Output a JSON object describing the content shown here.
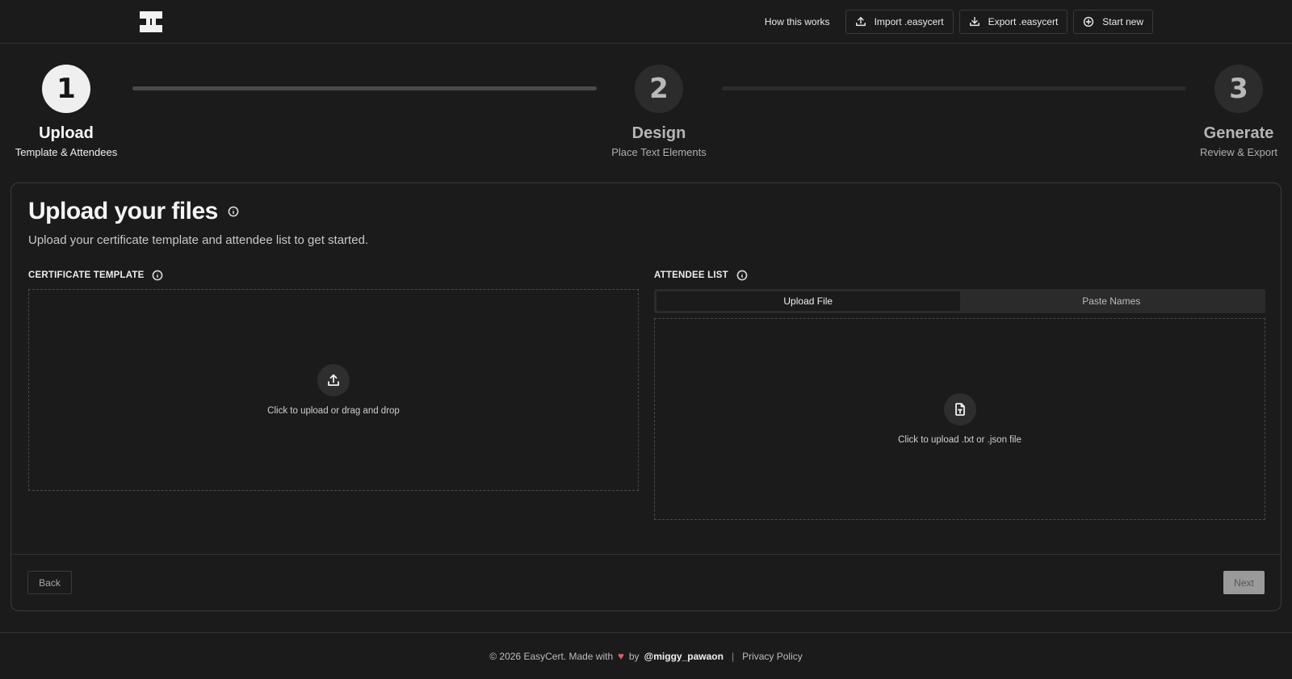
{
  "header": {
    "logo_icon": "easycert-logo-icon",
    "how_it_works": "How this works",
    "import_label": "Import .easycert",
    "import_icon": "upload-icon",
    "export_label": "Export .easycert",
    "export_icon": "download-icon",
    "start_new_label": "Start new",
    "start_new_icon": "plus-circle-icon"
  },
  "stepper": {
    "steps": [
      {
        "number": "1",
        "title": "Upload",
        "subtitle": "Template & Attendees",
        "state": "active"
      },
      {
        "number": "2",
        "title": "Design",
        "subtitle": "Place Text Elements",
        "state": "inactive"
      },
      {
        "number": "3",
        "title": "Generate",
        "subtitle": "Review & Export",
        "state": "inactive"
      }
    ],
    "colors": {
      "active_bar": "#4a4a4a",
      "inactive_bar": "#2c2c2c"
    }
  },
  "main": {
    "title": "Upload your files",
    "description": "Upload your certificate template and attendee list to get started.",
    "template": {
      "label": "CERTIFICATE TEMPLATE",
      "dropzone_text": "Click to upload or drag and drop",
      "dropzone_icon": "upload-icon"
    },
    "attendees": {
      "label": "ATTENDEE LIST",
      "tabs": [
        {
          "label": "Upload File",
          "active": true
        },
        {
          "label": "Paste Names",
          "active": false
        }
      ],
      "dropzone_text": "Click to upload .txt or .json file",
      "dropzone_icon": "file-text-icon"
    },
    "back_label": "Back",
    "next_label": "Next"
  },
  "footer": {
    "copyright": "© 2026 EasyCert. Made with",
    "heart": "♥",
    "by": "by",
    "handle": "@miggy_pawaon",
    "separator": "|",
    "privacy": "Privacy Policy"
  },
  "colors": {
    "background": "#1b1b1b",
    "border": "#3a3a3a",
    "accent_heart": "#e85a71"
  }
}
